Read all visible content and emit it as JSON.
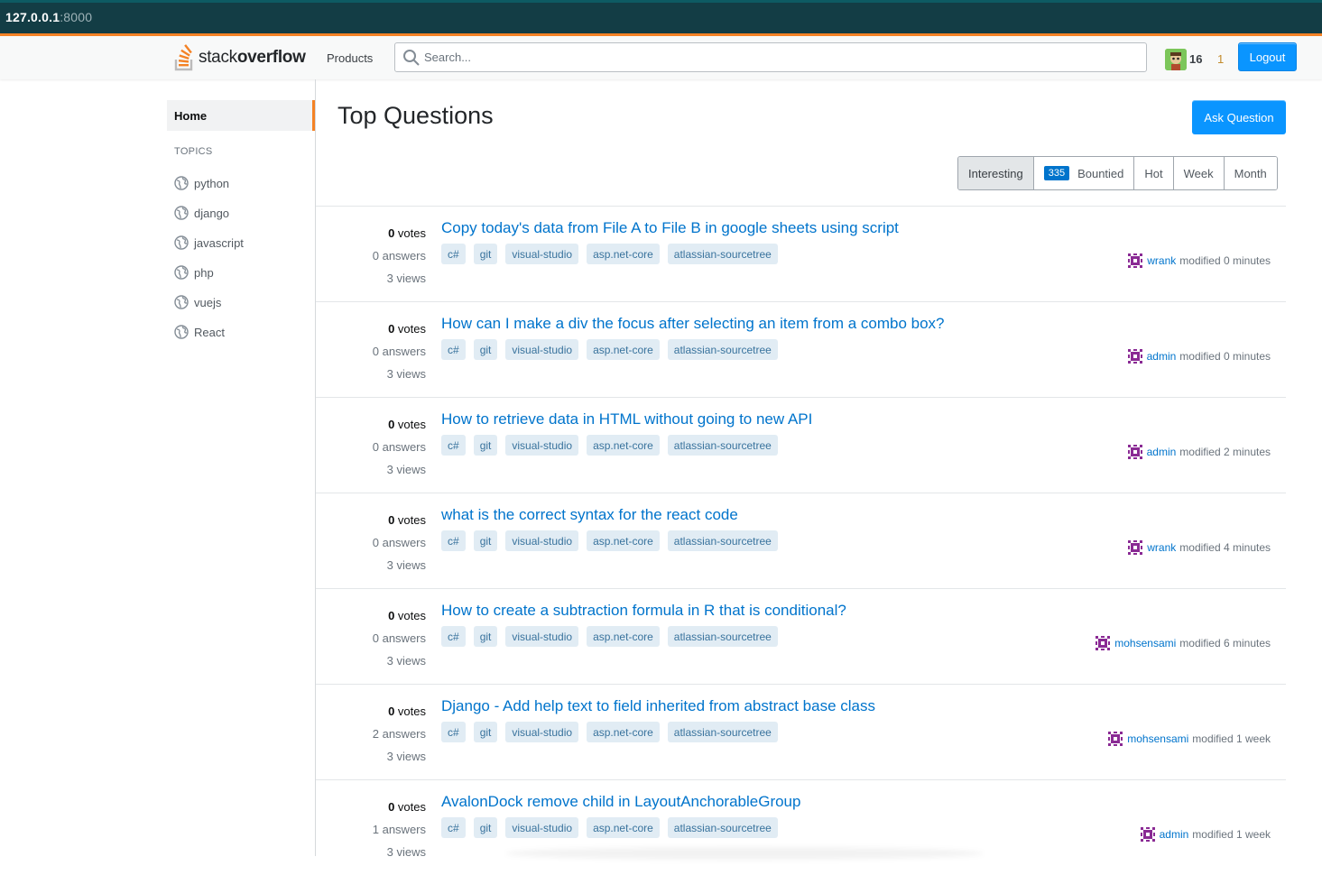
{
  "browser": {
    "host": "127.0.0.1",
    "port": ":8000"
  },
  "header": {
    "logo_light": "stack",
    "logo_bold": "overflow",
    "products_label": "Products",
    "search_placeholder": "Search...",
    "reputation": "16",
    "badge_count": "1",
    "logout_label": "Logout"
  },
  "sidebar": {
    "home_label": "Home",
    "topics_heading": "TOPICS",
    "topics": [
      "python",
      "django",
      "javascript",
      "php",
      "vuejs",
      "React"
    ]
  },
  "main": {
    "title": "Top Questions",
    "ask_label": "Ask Question",
    "filters": {
      "interesting": "Interesting",
      "bounty_count": "335",
      "bountied": "Bountied",
      "hot": "Hot",
      "week": "Week",
      "month": "Month"
    },
    "tags": [
      "c#",
      "git",
      "visual-studio",
      "asp.net-core",
      "atlassian-sourcetree"
    ],
    "questions": [
      {
        "votes": "0",
        "votes_label": "votes",
        "answers": "0 answers",
        "views": "3 views",
        "title": "Copy today's data from File A to File B in google sheets using script",
        "user": "wrank",
        "modified": "modified 0 minutes"
      },
      {
        "votes": "0",
        "votes_label": "votes",
        "answers": "0 answers",
        "views": "3 views",
        "title": "How can I make a div the focus after selecting an item from a combo box?",
        "user": "admin",
        "modified": "modified 0 minutes"
      },
      {
        "votes": "0",
        "votes_label": "votes",
        "answers": "0 answers",
        "views": "3 views",
        "title": "How to retrieve data in HTML without going to new API",
        "user": "admin",
        "modified": "modified 2 minutes"
      },
      {
        "votes": "0",
        "votes_label": "votes",
        "answers": "0 answers",
        "views": "3 views",
        "title": "what is the correct syntax for the react code",
        "user": "wrank",
        "modified": "modified 4 minutes"
      },
      {
        "votes": "0",
        "votes_label": "votes",
        "answers": "0 answers",
        "views": "3 views",
        "title": "How to create a subtraction formula in R that is conditional?",
        "user": "mohsensami",
        "modified": "modified 6 minutes"
      },
      {
        "votes": "0",
        "votes_label": "votes",
        "answers": "2 answers",
        "views": "3 views",
        "title": "Django - Add help text to field inherited from abstract base class",
        "user": "mohsensami",
        "modified": "modified 1 week"
      },
      {
        "votes": "0",
        "votes_label": "votes",
        "answers": "1 answers",
        "views": "3 views",
        "title": "AvalonDock remove child in LayoutAnchorableGroup",
        "user": "admin",
        "modified": "modified 1 week"
      }
    ]
  },
  "colors": {
    "accent": "#f48225",
    "link": "#0074cc",
    "primary_button": "#0a95ff",
    "tag_bg": "#e1ecf4",
    "tag_text": "#39739d"
  },
  "icons": {
    "logo": "stackoverflow-logo-icon",
    "search": "search-icon",
    "topic": "globe-icon",
    "user": "identicon-icon"
  }
}
